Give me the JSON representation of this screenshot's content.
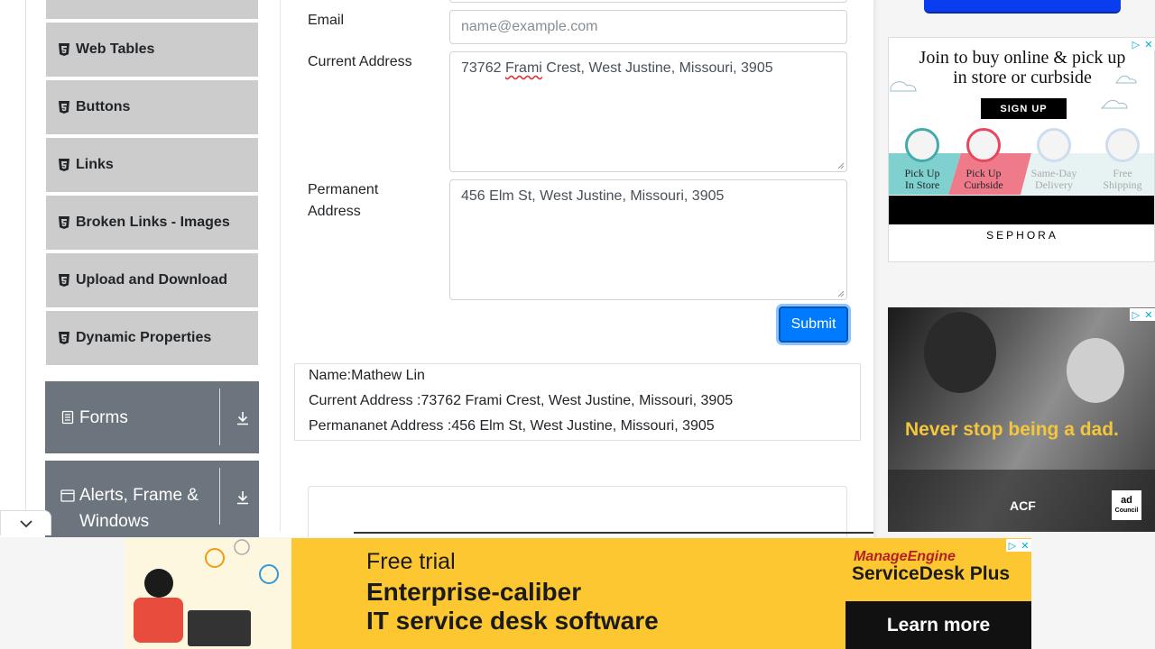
{
  "sidebar": {
    "items": [
      {
        "label": "Web Tables"
      },
      {
        "label": "Buttons"
      },
      {
        "label": "Links"
      },
      {
        "label": "Broken Links - Images"
      },
      {
        "label": "Upload and Download"
      },
      {
        "label": "Dynamic Properties"
      }
    ],
    "groups": [
      {
        "label": "Forms",
        "icon": "document-icon"
      },
      {
        "label": "Alerts, Frame & Windows",
        "icon": "window-icon"
      }
    ]
  },
  "form": {
    "email_label": "Email",
    "email_placeholder": "name@example.com",
    "current_address_label": "Current Address",
    "current_address_value_pre": "73762 ",
    "current_address_value_mark": "Frami",
    "current_address_value_post": " Crest, West Justine, Missouri, 3905",
    "permanent_address_label_1": "Permanent",
    "permanent_address_label_2": "Address",
    "permanent_address_value": "456 Elm St, West Justine, Missouri, 3905",
    "submit_label": "Submit"
  },
  "output": {
    "name": "Name:Mathew Lin",
    "current_address": "Current Address :73762 Frami Crest, West Justine, Missouri, 3905",
    "permanent_address": "Permananet Address :456 Elm St, West Justine, Missouri, 3905"
  },
  "ads": {
    "sephora": {
      "headline_1": "Join to buy online & pick up",
      "headline_2": "in store or curbside",
      "cta": "SIGN UP",
      "options": [
        {
          "l1": "Pick Up",
          "l2": "In Store"
        },
        {
          "l1": "Pick Up",
          "l2": "Curbside"
        },
        {
          "l1": "Same-Day",
          "l2": "Delivery"
        },
        {
          "l1": "Free",
          "l2": "Shipping"
        }
      ],
      "brand": "SEPHORA"
    },
    "dad": {
      "headline": "Never stop being a dad.",
      "logo_acf": "ACF",
      "logo_adcouncil_1": "ad",
      "logo_adcouncil_2": "Council"
    },
    "bottom": {
      "line_1": "Free trial",
      "line_2": "Enterprise-caliber",
      "line_3": "IT service desk software",
      "brand_1": "ManageEngine",
      "brand_2": "ServiceDesk Plus",
      "cta": "Learn more"
    }
  },
  "colors": {
    "primary": "#007bff",
    "sidebar_item_bg": "#cccccc",
    "group_header_bg": "#6c757d",
    "ad_bottom_bg": "#fcc731",
    "dad_headline": "#f3c63c"
  }
}
